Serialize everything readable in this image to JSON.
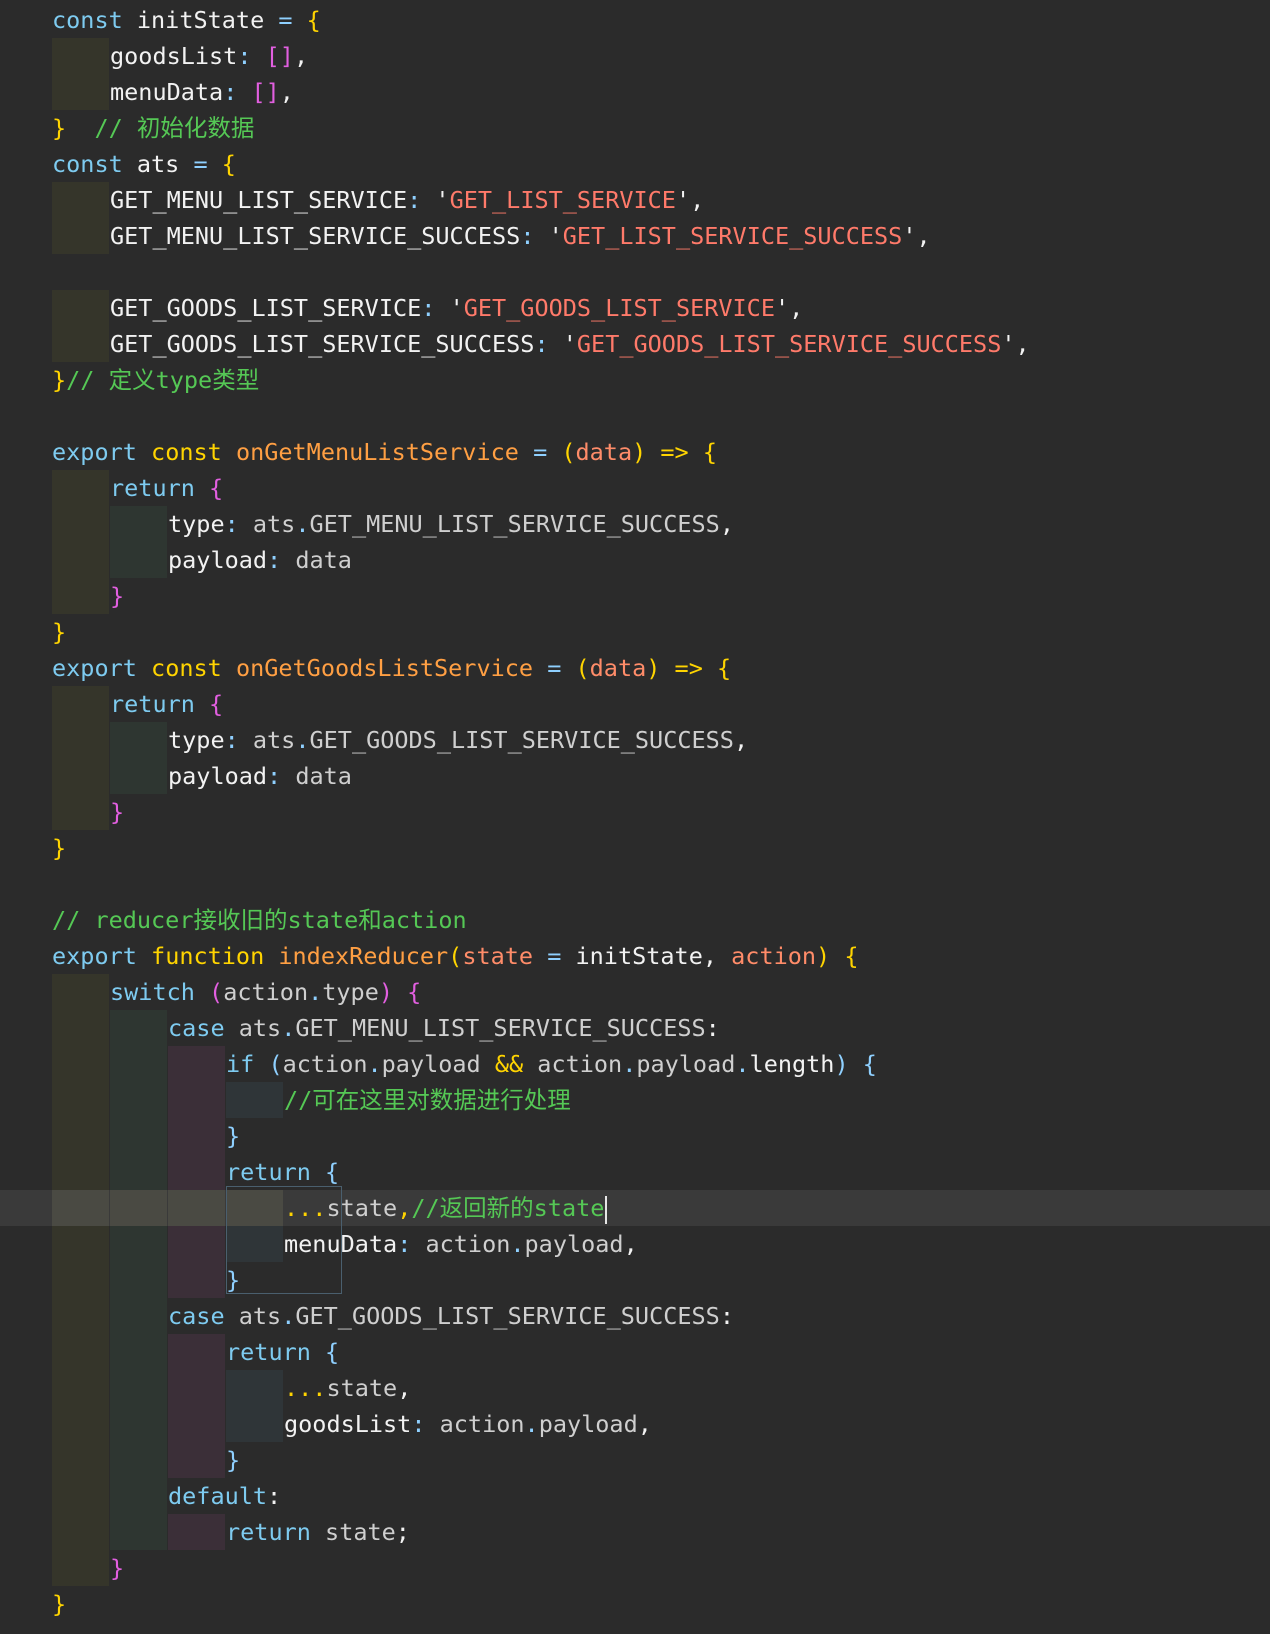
{
  "colors": {
    "background": "#2b2b2b",
    "keyword": "#7ecbf0",
    "plain": "#f2f2f2",
    "gray": "#cfcfcf",
    "yellow": "#ffd400",
    "magenta": "#e25fe0",
    "comment": "#55c855",
    "string": "#ff7a6a",
    "func": "#ff9f43",
    "param": "#ff8c69",
    "op": "#8fd0ff"
  },
  "cursor": {
    "line": 33
  },
  "lines": [
    {
      "indent": 0,
      "tokens": [
        [
          "const ",
          "k"
        ],
        [
          "initState ",
          "p"
        ],
        [
          "= ",
          "o"
        ],
        [
          "{",
          "y"
        ]
      ]
    },
    {
      "indent": 1,
      "tokens": [
        [
          "goodsList",
          "p"
        ],
        [
          ": ",
          "o"
        ],
        [
          "[]",
          "m"
        ],
        [
          ",",
          "p"
        ]
      ]
    },
    {
      "indent": 1,
      "tokens": [
        [
          "menuData",
          "p"
        ],
        [
          ": ",
          "o"
        ],
        [
          "[]",
          "m"
        ],
        [
          ",",
          "p"
        ]
      ]
    },
    {
      "indent": 0,
      "tokens": [
        [
          "}",
          "y"
        ],
        [
          "  // 初始化数据",
          "c"
        ]
      ]
    },
    {
      "indent": 0,
      "tokens": [
        [
          "const ",
          "k"
        ],
        [
          "ats ",
          "p"
        ],
        [
          "= ",
          "o"
        ],
        [
          "{",
          "y"
        ]
      ]
    },
    {
      "indent": 1,
      "tokens": [
        [
          "GET_MENU_LIST_SERVICE",
          "p"
        ],
        [
          ": ",
          "o"
        ],
        [
          "'",
          "p"
        ],
        [
          "GET_LIST_SERVICE",
          "s"
        ],
        [
          "',",
          "p"
        ]
      ]
    },
    {
      "indent": 1,
      "tokens": [
        [
          "GET_MENU_LIST_SERVICE_SUCCESS",
          "p"
        ],
        [
          ": ",
          "o"
        ],
        [
          "'",
          "p"
        ],
        [
          "GET_LIST_SERVICE_SUCCESS",
          "s"
        ],
        [
          "',",
          "p"
        ]
      ]
    },
    {
      "indent": 0,
      "tokens": []
    },
    {
      "indent": 1,
      "tokens": [
        [
          "GET_GOODS_LIST_SERVICE",
          "p"
        ],
        [
          ": ",
          "o"
        ],
        [
          "'",
          "p"
        ],
        [
          "GET_GOODS_LIST_SERVICE",
          "s"
        ],
        [
          "',",
          "p"
        ]
      ]
    },
    {
      "indent": 1,
      "tokens": [
        [
          "GET_GOODS_LIST_SERVICE_SUCCESS",
          "p"
        ],
        [
          ": ",
          "o"
        ],
        [
          "'",
          "p"
        ],
        [
          "GET_GOODS_LIST_SERVICE_SUCCESS",
          "s"
        ],
        [
          "',",
          "p"
        ]
      ]
    },
    {
      "indent": 0,
      "tokens": [
        [
          "}",
          "y"
        ],
        [
          "// 定义type类型",
          "c"
        ]
      ]
    },
    {
      "indent": 0,
      "tokens": []
    },
    {
      "indent": 0,
      "tokens": [
        [
          "export ",
          "k"
        ],
        [
          "const ",
          "y"
        ],
        [
          "onGetMenuListService ",
          "f"
        ],
        [
          "= ",
          "o"
        ],
        [
          "(",
          "y"
        ],
        [
          "data",
          "a"
        ],
        [
          ") ",
          "y"
        ],
        [
          "=> ",
          "y"
        ],
        [
          "{",
          "y"
        ]
      ]
    },
    {
      "indent": 1,
      "tokens": [
        [
          "return ",
          "k"
        ],
        [
          "{",
          "m"
        ]
      ]
    },
    {
      "indent": 2,
      "tokens": [
        [
          "type",
          "p"
        ],
        [
          ": ",
          "o"
        ],
        [
          "ats",
          "g"
        ],
        [
          ".",
          "o"
        ],
        [
          "GET_MENU_LIST_SERVICE_SUCCESS",
          "g"
        ],
        [
          ",",
          "p"
        ]
      ]
    },
    {
      "indent": 2,
      "tokens": [
        [
          "payload",
          "p"
        ],
        [
          ": ",
          "o"
        ],
        [
          "data",
          "g"
        ]
      ]
    },
    {
      "indent": 1,
      "tokens": [
        [
          "}",
          "m"
        ]
      ]
    },
    {
      "indent": 0,
      "tokens": [
        [
          "}",
          "y"
        ]
      ]
    },
    {
      "indent": 0,
      "tokens": [
        [
          "export ",
          "k"
        ],
        [
          "const ",
          "y"
        ],
        [
          "onGetGoodsListService ",
          "f"
        ],
        [
          "= ",
          "o"
        ],
        [
          "(",
          "y"
        ],
        [
          "data",
          "a"
        ],
        [
          ") ",
          "y"
        ],
        [
          "=> ",
          "y"
        ],
        [
          "{",
          "y"
        ]
      ]
    },
    {
      "indent": 1,
      "tokens": [
        [
          "return ",
          "k"
        ],
        [
          "{",
          "m"
        ]
      ]
    },
    {
      "indent": 2,
      "tokens": [
        [
          "type",
          "p"
        ],
        [
          ": ",
          "o"
        ],
        [
          "ats",
          "g"
        ],
        [
          ".",
          "o"
        ],
        [
          "GET_GOODS_LIST_SERVICE_SUCCESS",
          "g"
        ],
        [
          ",",
          "p"
        ]
      ]
    },
    {
      "indent": 2,
      "tokens": [
        [
          "payload",
          "p"
        ],
        [
          ": ",
          "o"
        ],
        [
          "data",
          "g"
        ]
      ]
    },
    {
      "indent": 1,
      "tokens": [
        [
          "}",
          "m"
        ]
      ]
    },
    {
      "indent": 0,
      "tokens": [
        [
          "}",
          "y"
        ]
      ]
    },
    {
      "indent": 0,
      "tokens": []
    },
    {
      "indent": 0,
      "tokens": [
        [
          "// reducer接收旧的state和action",
          "c"
        ]
      ]
    },
    {
      "indent": 0,
      "tokens": [
        [
          "export ",
          "k"
        ],
        [
          "function ",
          "y"
        ],
        [
          "indexReducer",
          "f"
        ],
        [
          "(",
          "y"
        ],
        [
          "state ",
          "a"
        ],
        [
          "= ",
          "o"
        ],
        [
          "initState",
          "p"
        ],
        [
          ", ",
          "p"
        ],
        [
          "action",
          "a"
        ],
        [
          ") ",
          "y"
        ],
        [
          "{",
          "y"
        ]
      ]
    },
    {
      "indent": 1,
      "tokens": [
        [
          "switch ",
          "k"
        ],
        [
          "(",
          "m"
        ],
        [
          "action",
          "g"
        ],
        [
          ".",
          "o"
        ],
        [
          "type",
          "g"
        ],
        [
          ") ",
          "m"
        ],
        [
          "{",
          "m"
        ]
      ]
    },
    {
      "indent": 2,
      "tokens": [
        [
          "case ",
          "k"
        ],
        [
          "ats",
          "g"
        ],
        [
          ".",
          "o"
        ],
        [
          "GET_MENU_LIST_SERVICE_SUCCESS",
          "g"
        ],
        [
          ":",
          "p"
        ]
      ]
    },
    {
      "indent": 3,
      "tokens": [
        [
          "if ",
          "k"
        ],
        [
          "(",
          "op"
        ],
        [
          "action",
          "g"
        ],
        [
          ".",
          "o"
        ],
        [
          "payload ",
          "g"
        ],
        [
          "&& ",
          "y"
        ],
        [
          "action",
          "g"
        ],
        [
          ".",
          "o"
        ],
        [
          "payload",
          "g"
        ],
        [
          ".",
          "o"
        ],
        [
          "length",
          "p"
        ],
        [
          ") ",
          "op"
        ],
        [
          "{",
          "op"
        ]
      ]
    },
    {
      "indent": 4,
      "tokens": [
        [
          "//可在这里对数据进行处理",
          "c"
        ]
      ]
    },
    {
      "indent": 3,
      "tokens": [
        [
          "}",
          "op"
        ]
      ]
    },
    {
      "indent": 3,
      "tokens": [
        [
          "return ",
          "k"
        ],
        [
          "{",
          "op"
        ]
      ]
    },
    {
      "indent": 4,
      "tokens": [
        [
          "...",
          "y"
        ],
        [
          "state",
          "g"
        ],
        [
          ",",
          "y"
        ],
        [
          "//返回新的state",
          "c"
        ]
      ]
    },
    {
      "indent": 4,
      "tokens": [
        [
          "menuData",
          "p"
        ],
        [
          ": ",
          "o"
        ],
        [
          "action",
          "g"
        ],
        [
          ".",
          "o"
        ],
        [
          "payload",
          "g"
        ],
        [
          ",",
          "p"
        ]
      ]
    },
    {
      "indent": 3,
      "tokens": [
        [
          "}",
          "op"
        ]
      ]
    },
    {
      "indent": 2,
      "tokens": [
        [
          "case ",
          "k"
        ],
        [
          "ats",
          "g"
        ],
        [
          ".",
          "o"
        ],
        [
          "GET_GOODS_LIST_SERVICE_SUCCESS",
          "g"
        ],
        [
          ":",
          "p"
        ]
      ]
    },
    {
      "indent": 3,
      "tokens": [
        [
          "return ",
          "k"
        ],
        [
          "{",
          "op"
        ]
      ]
    },
    {
      "indent": 4,
      "tokens": [
        [
          "...",
          "y"
        ],
        [
          "state",
          "g"
        ],
        [
          ",",
          "p"
        ]
      ]
    },
    {
      "indent": 4,
      "tokens": [
        [
          "goodsList",
          "p"
        ],
        [
          ": ",
          "o"
        ],
        [
          "action",
          "g"
        ],
        [
          ".",
          "o"
        ],
        [
          "payload",
          "g"
        ],
        [
          ",",
          "p"
        ]
      ]
    },
    {
      "indent": 3,
      "tokens": [
        [
          "}",
          "op"
        ]
      ]
    },
    {
      "indent": 2,
      "tokens": [
        [
          "default",
          "k"
        ],
        [
          ":",
          "p"
        ]
      ]
    },
    {
      "indent": 3,
      "tokens": [
        [
          "return ",
          "k"
        ],
        [
          "state",
          "g"
        ],
        [
          ";",
          "p"
        ]
      ]
    },
    {
      "indent": 1,
      "tokens": [
        [
          "}",
          "m"
        ]
      ]
    },
    {
      "indent": 0,
      "tokens": [
        [
          "}",
          "y"
        ]
      ]
    }
  ]
}
